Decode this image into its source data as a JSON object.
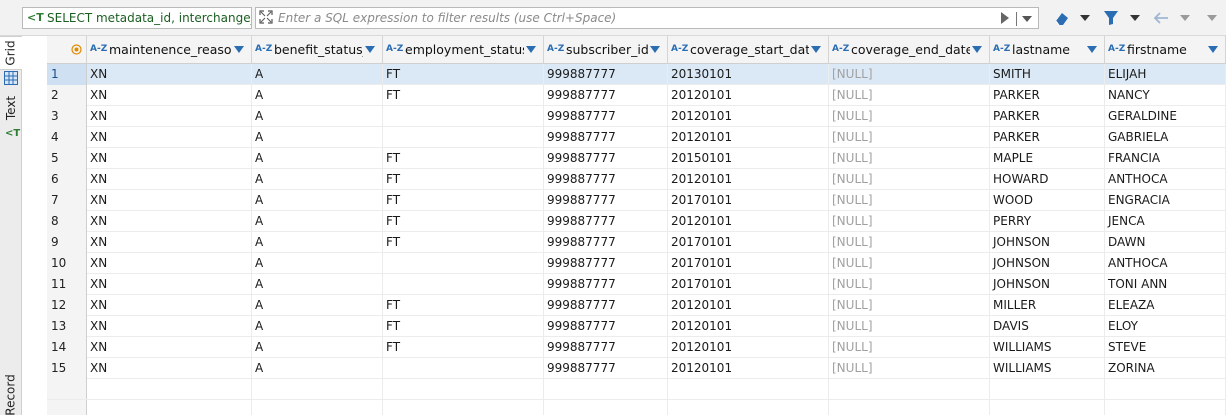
{
  "filter_bar": {
    "sql_text": "SELECT metadata_id, interchange_co",
    "filter_placeholder": "Enter a SQL expression to filter results (use Ctrl+Space)"
  },
  "side_tabs": {
    "grid": "Grid",
    "text": "Text",
    "record": "Record"
  },
  "columns": [
    {
      "type": "A-Z",
      "name": "maintenence_reason_"
    },
    {
      "type": "A-Z",
      "name": "benefit_status_"
    },
    {
      "type": "A-Z",
      "name": "employment_status_"
    },
    {
      "type": "A-Z",
      "name": "subscriber_id"
    },
    {
      "type": "A-Z",
      "name": "coverage_start_date"
    },
    {
      "type": "A-Z",
      "name": "coverage_end_date"
    },
    {
      "type": "A-Z",
      "name": "lastname"
    },
    {
      "type": "A-Z",
      "name": "firstname"
    }
  ],
  "rows": [
    {
      "n": "1",
      "c": [
        "XN",
        "A",
        "FT",
        "999887777",
        "20130101",
        "[NULL]",
        "SMITH",
        "ELIJAH"
      ]
    },
    {
      "n": "2",
      "c": [
        "XN",
        "A",
        "FT",
        "999887777",
        "20120101",
        "[NULL]",
        "PARKER",
        "NANCY"
      ]
    },
    {
      "n": "3",
      "c": [
        "XN",
        "A",
        "",
        "999887777",
        "20120101",
        "[NULL]",
        "PARKER",
        "GERALDINE"
      ]
    },
    {
      "n": "4",
      "c": [
        "XN",
        "A",
        "",
        "999887777",
        "20120101",
        "[NULL]",
        "PARKER",
        "GABRIELA"
      ]
    },
    {
      "n": "5",
      "c": [
        "XN",
        "A",
        "FT",
        "999887777",
        "20150101",
        "[NULL]",
        "MAPLE",
        "FRANCIA"
      ]
    },
    {
      "n": "6",
      "c": [
        "XN",
        "A",
        "FT",
        "999887777",
        "20120101",
        "[NULL]",
        "HOWARD",
        "ANTHOCA"
      ]
    },
    {
      "n": "7",
      "c": [
        "XN",
        "A",
        "FT",
        "999887777",
        "20170101",
        "[NULL]",
        "WOOD",
        "ENGRACIA"
      ]
    },
    {
      "n": "8",
      "c": [
        "XN",
        "A",
        "FT",
        "999887777",
        "20120101",
        "[NULL]",
        "PERRY",
        "JENCA"
      ]
    },
    {
      "n": "9",
      "c": [
        "XN",
        "A",
        "FT",
        "999887777",
        "20170101",
        "[NULL]",
        "JOHNSON",
        "DAWN"
      ]
    },
    {
      "n": "10",
      "c": [
        "XN",
        "A",
        "",
        "999887777",
        "20170101",
        "[NULL]",
        "JOHNSON",
        "ANTHOCA"
      ]
    },
    {
      "n": "11",
      "c": [
        "XN",
        "A",
        "",
        "999887777",
        "20170101",
        "[NULL]",
        "JOHNSON",
        "TONI ANN"
      ]
    },
    {
      "n": "12",
      "c": [
        "XN",
        "A",
        "FT",
        "999887777",
        "20120101",
        "[NULL]",
        "MILLER",
        "ELEAZA"
      ]
    },
    {
      "n": "13",
      "c": [
        "XN",
        "A",
        "FT",
        "999887777",
        "20120101",
        "[NULL]",
        "DAVIS",
        "ELOY"
      ]
    },
    {
      "n": "14",
      "c": [
        "XN",
        "A",
        "FT",
        "999887777",
        "20120101",
        "[NULL]",
        "WILLIAMS",
        "STEVE"
      ]
    },
    {
      "n": "15",
      "c": [
        "XN",
        "A",
        "",
        "999887777",
        "20120101",
        "[NULL]",
        "WILLIAMS",
        "ZORINA"
      ]
    }
  ],
  "colors": {
    "selected_row": "#dbe9f7",
    "type_badge": "#2a6db3",
    "null_text": "#a0a0a0",
    "sql_text": "#1a5e20"
  }
}
